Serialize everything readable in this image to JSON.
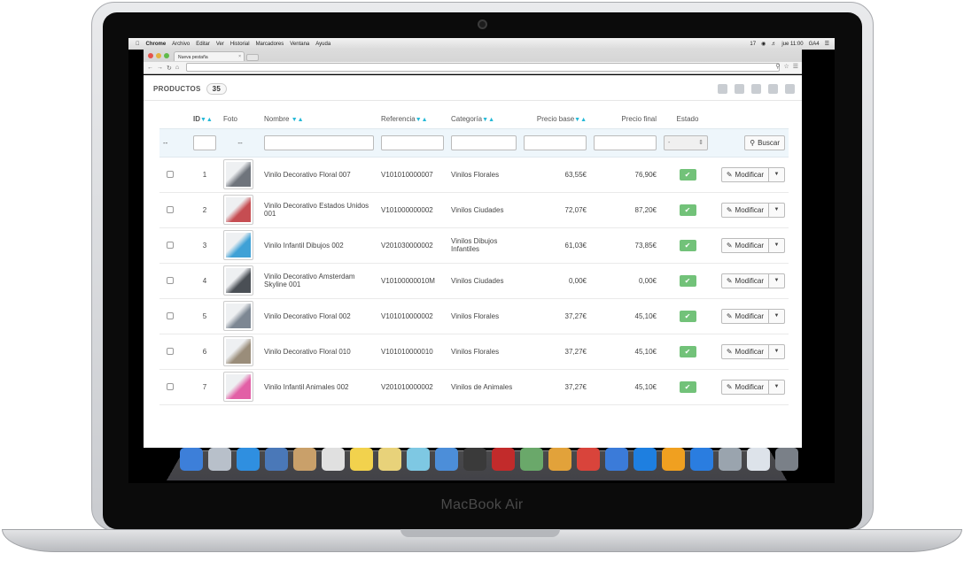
{
  "device": {
    "label": "MacBook Air"
  },
  "menubar": {
    "app": "Chrome",
    "items": [
      "Archivo",
      "Editar",
      "Ver",
      "Historial",
      "Marcadores",
      "Ventana",
      "Ayuda"
    ],
    "status": {
      "badge": "17",
      "clock": "jue 11:00",
      "user": "GA4"
    }
  },
  "browser": {
    "tab_title": "Nueva pestaña"
  },
  "page": {
    "title": "PRODUCTOS",
    "count": "35"
  },
  "table": {
    "headers": [
      "ID",
      "Foto",
      "Nombre",
      "Referencia",
      "Categoría",
      "Precio base",
      "Precio final",
      "Estado"
    ],
    "filter": {
      "id_dash": "--",
      "foto_dash": "--",
      "estado_select": "-",
      "search_button": "Buscar"
    },
    "edit_label": "Modificar",
    "rows": [
      {
        "id": "1",
        "name": "Vinilo Decorativo Floral 007",
        "ref": "V101010000007",
        "cat": "Vinilos Florales",
        "base": "63,55€",
        "final": "76,90€",
        "thumb": "#6f747c"
      },
      {
        "id": "2",
        "name": "Vinilo Decorativo Estados Unidos 001",
        "ref": "V101000000002",
        "cat": "Vinilos Ciudades",
        "base": "72,07€",
        "final": "87,20€",
        "thumb": "#c64d52"
      },
      {
        "id": "3",
        "name": "Vinilo Infantil Dibujos 002",
        "ref": "V201030000002",
        "cat": "Vinilos Dibujos Infantiles",
        "base": "61,03€",
        "final": "73,85€",
        "thumb": "#3fa1d6"
      },
      {
        "id": "4",
        "name": "Vinilo Decorativo Amsterdam Skyline 001",
        "ref": "V10100000010M",
        "cat": "Vinilos Ciudades",
        "base": "0,00€",
        "final": "0,00€",
        "thumb": "#4a4f55"
      },
      {
        "id": "5",
        "name": "Vinilo Decorativo Floral 002",
        "ref": "V101010000002",
        "cat": "Vinilos Florales",
        "base": "37,27€",
        "final": "45,10€",
        "thumb": "#7d8793"
      },
      {
        "id": "6",
        "name": "Vinilo Decorativo Floral 010",
        "ref": "V101010000010",
        "cat": "Vinilos Florales",
        "base": "37,27€",
        "final": "45,10€",
        "thumb": "#9a8d7a"
      },
      {
        "id": "7",
        "name": "Vinilo Infantil Animales 002",
        "ref": "V201010000002",
        "cat": "Vinilos de Animales",
        "base": "37,27€",
        "final": "45,10€",
        "thumb": "#e25fa6"
      }
    ]
  },
  "colors": {
    "accent": "#25b9d7",
    "status_ok": "#72c279"
  }
}
